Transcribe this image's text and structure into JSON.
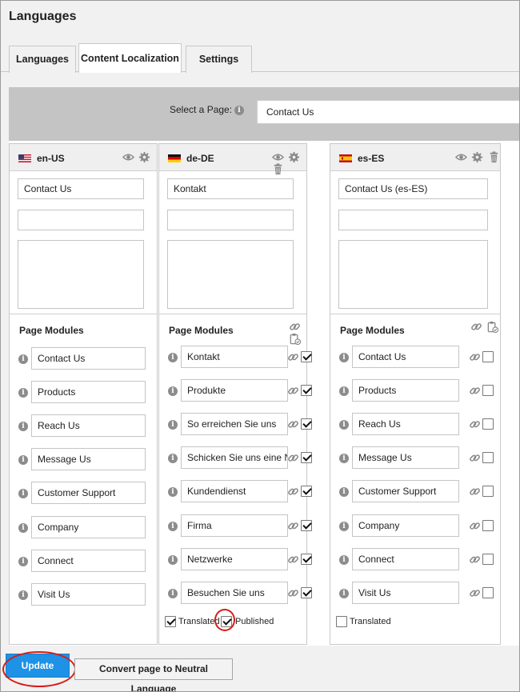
{
  "page_title": "Languages",
  "tabs": [
    {
      "label": "Languages"
    },
    {
      "label": "Content Localization"
    },
    {
      "label": "Settings"
    }
  ],
  "select_page": {
    "label": "Select a Page:",
    "value": "Contact Us"
  },
  "columns": [
    {
      "locale": "en-US",
      "flag": "us-flag",
      "title_value": "Contact Us",
      "field2_value": "",
      "field3_value": "",
      "page_modules_label": "Page Modules",
      "modules": [
        "Contact Us",
        "Products",
        "Reach Us",
        "Message Us",
        "Customer Support",
        "Company",
        "Connect",
        "Visit Us"
      ]
    },
    {
      "locale": "de-DE",
      "flag": "de-flag",
      "title_value": "Kontakt",
      "field2_value": "",
      "field3_value": "",
      "page_modules_label": "Page Modules",
      "modules": [
        "Kontakt",
        "Produkte",
        "So erreichen Sie uns",
        "Schicken Sie uns eine Na",
        "Kundendienst",
        "Firma",
        "Netzwerke",
        "Besuchen Sie uns"
      ],
      "modules_checked": [
        true,
        true,
        true,
        true,
        true,
        true,
        true,
        true
      ],
      "translated_label": "Translated",
      "translated_checked": true,
      "published_label": "Published",
      "published_checked": true
    },
    {
      "locale": "es-ES",
      "flag": "es-flag",
      "title_value": "Contact Us (es-ES)",
      "field2_value": "",
      "field3_value": "",
      "page_modules_label": "Page Modules",
      "modules": [
        "Contact Us",
        "Products",
        "Reach Us",
        "Message Us",
        "Customer Support",
        "Company",
        "Connect",
        "Visit Us"
      ],
      "modules_checked": [
        false,
        false,
        false,
        false,
        false,
        false,
        false,
        false
      ],
      "translated_label": "Translated",
      "translated_checked": false
    }
  ],
  "buttons": {
    "update_label": "Update",
    "convert_label": "Convert page to Neutral Language"
  },
  "colors": {
    "update_button": "#1d92e6",
    "highlight_ring": "#d71a1a"
  }
}
